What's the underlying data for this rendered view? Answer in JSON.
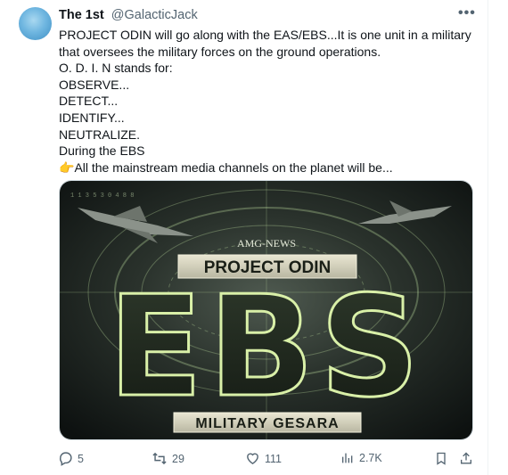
{
  "author": {
    "name": "The 1st",
    "handle": "@GalacticJack"
  },
  "more_label": "•••",
  "tweet_lines": [
    "PROJECT ODIN will go along with the EAS/EBS...It is one unit in a military",
    "that oversees the military forces on the ground operations.",
    "O. D. I. N stands for:",
    "OBSERVE...",
    "DETECT...",
    "IDENTIFY...",
    "NEUTRALIZE.",
    "During the EBS",
    "All the mainstream media channels on the planet will be..."
  ],
  "pointing_emoji": "👉",
  "image": {
    "watermark": "AMG-NEWS",
    "title": "PROJECT ODIN",
    "big_text": "EBS",
    "subtitle": "MILITARY GESARA",
    "hud_text": "1 1 3 5 3 0 4 8 8"
  },
  "actions": {
    "replies": "5",
    "reposts": "29",
    "likes": "111",
    "views": "2.7K"
  },
  "icons": {
    "reply": "reply-icon",
    "repost": "repost-icon",
    "like": "heart-icon",
    "views": "views-icon",
    "bookmark": "bookmark-icon",
    "share": "share-icon"
  },
  "colors": {
    "text": "#0f1419",
    "muted": "#536471",
    "image_glow": "#c8e6a0"
  }
}
